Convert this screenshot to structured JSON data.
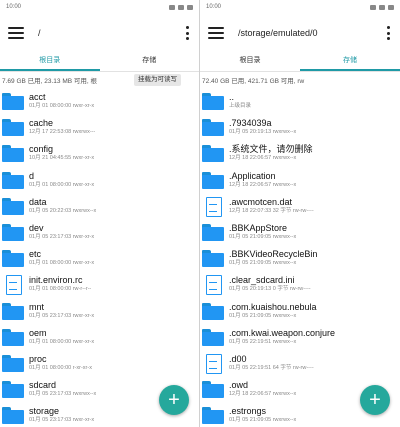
{
  "left": {
    "status_time": "10:00",
    "path_title": "/",
    "tabs": [
      {
        "label": "根目录"
      },
      {
        "label": "存储"
      }
    ],
    "info": "7.69 GB 已用, 23.13 MB 可用, 根",
    "info_button": "挂载为可读写",
    "items": [
      {
        "type": "folder",
        "name": "acct",
        "meta": "01月 01 08:00:00  rwxr-xr-x"
      },
      {
        "type": "folder",
        "name": "cache",
        "meta": "12月 17 22:53:08  rwxrwx---"
      },
      {
        "type": "folder",
        "name": "config",
        "meta": "10月 21 04:45:55  rwxr-xr-x"
      },
      {
        "type": "folder",
        "name": "d",
        "meta": "01月 01 08:00:00  rwxr-xr-x"
      },
      {
        "type": "folder",
        "name": "data",
        "meta": "01月 05 20:22:03  rwxrwx--x"
      },
      {
        "type": "folder",
        "name": "dev",
        "meta": "01月 05 23:17:03  rwxr-xr-x"
      },
      {
        "type": "folder",
        "name": "etc",
        "meta": "01月 01 08:00:00  rwxr-xr-x"
      },
      {
        "type": "file",
        "name": "init.environ.rc",
        "meta": "01月 01 08:00:00  rw-r--r--"
      },
      {
        "type": "folder",
        "name": "mnt",
        "meta": "01月 05 23:17:03  rwxr-xr-x"
      },
      {
        "type": "folder",
        "name": "oem",
        "meta": "01月 01 08:00:00  rwxr-xr-x"
      },
      {
        "type": "folder",
        "name": "proc",
        "meta": "01月 01 08:00:00  r-xr-xr-x"
      },
      {
        "type": "folder",
        "name": "sdcard",
        "meta": "01月 05 23:17:03  rwxrwx--x"
      },
      {
        "type": "folder",
        "name": "storage",
        "meta": "01月 05 23:17:03  rwxr-xr-x"
      }
    ],
    "fab_label": "+"
  },
  "right": {
    "status_time": "10:00",
    "path_title": "/storage/emulated/0",
    "tabs": [
      {
        "label": "根目录"
      },
      {
        "label": "存储"
      }
    ],
    "info": "72.40 GB 已用, 421.71 GB 可用, rw",
    "items": [
      {
        "type": "folder",
        "name": "..",
        "meta": "上级目录"
      },
      {
        "type": "folder",
        "name": ".7934039a",
        "meta": "01月 05 20:19:13  rwxrwx--x"
      },
      {
        "type": "folder",
        "name": ".系统文件，请勿删除",
        "meta": "12月 18 22:06:57  rwxrwx--x"
      },
      {
        "type": "folder",
        "name": ".Application",
        "meta": "12月 18 22:06:57  rwxrwx--x"
      },
      {
        "type": "file",
        "name": ".awcmotcen.dat",
        "meta": "12月 18 22:07:33  32 字节  rw-rw----"
      },
      {
        "type": "folder",
        "name": ".BBKAppStore",
        "meta": "01月 05 21:09:05  rwxrwx--x"
      },
      {
        "type": "folder",
        "name": ".BBKVideoRecycleBin",
        "meta": "01月 05 21:09:05  rwxrwx--x"
      },
      {
        "type": "file",
        "name": ".clear_sdcard.ini",
        "meta": "01月 05 20:19:13  0 字节  rw-rw----"
      },
      {
        "type": "folder",
        "name": ".com.kuaishou.nebula",
        "meta": "01月 05 21:09:05  rwxrwx--x"
      },
      {
        "type": "folder",
        "name": ".com.kwai.weapon.conjure",
        "meta": "01月 05 22:19:51  rwxrwx--x"
      },
      {
        "type": "file",
        "name": ".d00",
        "meta": "01月 05 22:19:51  64 字节  rw-rw----"
      },
      {
        "type": "folder",
        "name": ".owd",
        "meta": "12月 18 22:06:57  rwxrwx--x"
      },
      {
        "type": "folder",
        "name": ".estrongs",
        "meta": "01月 05 21:09:05  rwxrwx--x"
      }
    ],
    "fab_label": "+"
  }
}
